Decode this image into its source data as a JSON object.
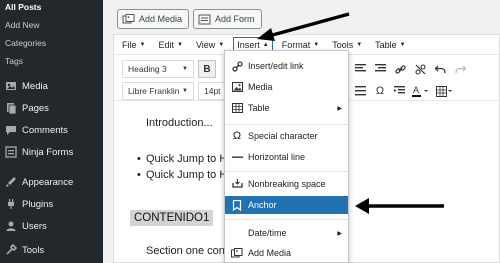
{
  "sidebar": {
    "submenu": [
      "All Posts",
      "Add New",
      "Categories",
      "Tags"
    ],
    "menu": [
      {
        "label": "Media",
        "icon": "media-icon"
      },
      {
        "label": "Pages",
        "icon": "pages-icon"
      },
      {
        "label": "Comments",
        "icon": "comments-icon"
      },
      {
        "label": "Ninja Forms",
        "icon": "forms-icon"
      },
      {
        "label": "Appearance",
        "icon": "appearance-icon"
      },
      {
        "label": "Plugins",
        "icon": "plugins-icon"
      },
      {
        "label": "Users",
        "icon": "users-icon"
      },
      {
        "label": "Tools",
        "icon": "tools-icon"
      }
    ]
  },
  "buttons": {
    "add_media": "Add Media",
    "add_form": "Add Form"
  },
  "menubar": [
    "File",
    "Edit",
    "View",
    "Insert",
    "Format",
    "Tools",
    "Table"
  ],
  "toolbar": {
    "block_format": "Heading 3",
    "font_family": "Libre Franklin",
    "font_size": "14pt",
    "bold": "B"
  },
  "content": {
    "intro": "Introduction...",
    "bullet1": "Quick Jump to He",
    "bullet2": "Quick Jump to He",
    "heading": "CONTENIDO1",
    "section": "Section one cont"
  },
  "insert_menu": [
    {
      "label": "Insert/edit link",
      "icon": "link-icon"
    },
    {
      "label": "Media",
      "icon": "image-icon"
    },
    {
      "label": "Table",
      "icon": "table-icon",
      "submenu": true
    },
    {
      "label": "Special character",
      "icon": "omega-icon"
    },
    {
      "label": "Horizontal line",
      "icon": "hr-icon"
    },
    {
      "label": "Nonbreaking space",
      "icon": "nbsp-icon"
    },
    {
      "label": "Anchor",
      "icon": "bookmark-icon",
      "active": true
    },
    {
      "label": "Date/time",
      "icon": "",
      "submenu": true
    },
    {
      "label": "Add Media",
      "icon": "addmedia-icon"
    }
  ],
  "colors": {
    "sidebar": "#23282d",
    "accent": "#2271b1",
    "arrow": "#000000"
  }
}
